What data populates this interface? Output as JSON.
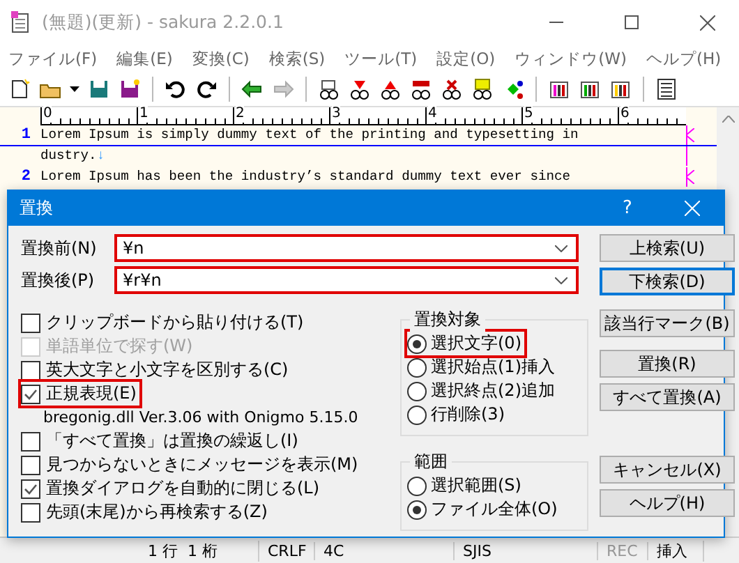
{
  "window": {
    "title": "(無題)(更新) - sakura 2.2.0.1"
  },
  "menu": [
    "ファイル(F)",
    "編集(E)",
    "変換(C)",
    "検索(S)",
    "ツール(T)",
    "設定(O)",
    "ウィンドウ(W)",
    "ヘルプ(H)"
  ],
  "ruler": [
    "0",
    "1",
    "2",
    "3",
    "4",
    "5",
    "6"
  ],
  "lines": [
    {
      "number": "1",
      "current": true,
      "rows": [
        {
          "text": "Lorem Ipsum is simply dummy text of the printing and typesetting in",
          "wrap": true
        },
        {
          "text": "dustry.",
          "wrap": false,
          "eol": "↓"
        }
      ]
    },
    {
      "number": "2",
      "current": false,
      "rows": [
        {
          "text": "Lorem Ipsum has been the industry’s standard dummy text ever since",
          "wrap": true
        }
      ]
    }
  ],
  "status": {
    "line": "1 行",
    "column": "1 桁",
    "eol": "CRLF",
    "code": "4C",
    "encoding": "SJIS",
    "rec": {
      "text": "REC",
      "on": false
    },
    "mode": "挿入"
  },
  "dialog": {
    "title": "置換",
    "help": "?",
    "fields": [
      {
        "label": "置換前(N)",
        "value": "¥n",
        "highlighted": true
      },
      {
        "label": "置換後(P)",
        "value": "¥r¥n",
        "highlighted": true
      }
    ],
    "options": [
      {
        "kind": "checkbox",
        "label": "クリップボードから貼り付ける(T)",
        "checked": false,
        "disabled": false,
        "highlighted": false
      },
      {
        "kind": "checkbox",
        "label": "単語単位で探す(W)",
        "checked": false,
        "disabled": true,
        "highlighted": false
      },
      {
        "kind": "checkbox",
        "label": "英大文字と小文字を区別する(C)",
        "checked": false,
        "disabled": false,
        "highlighted": false
      },
      {
        "kind": "checkbox",
        "label": "正規表現(E)",
        "checked": true,
        "disabled": false,
        "highlighted": true
      },
      {
        "kind": "note",
        "label": "bregonig.dll Ver.3.06 with Onigmo 5.15.0"
      },
      {
        "kind": "checkbox",
        "label": "「すべて置換」は置換の繰返し(I)",
        "checked": false,
        "disabled": false,
        "highlighted": false
      },
      {
        "kind": "checkbox",
        "label": "見つからないときにメッセージを表示(M)",
        "checked": false,
        "disabled": false,
        "highlighted": false
      },
      {
        "kind": "checkbox",
        "label": "置換ダイアログを自動的に閉じる(L)",
        "checked": true,
        "disabled": false,
        "highlighted": false
      },
      {
        "kind": "checkbox",
        "label": "先頭(末尾)から再検索する(Z)",
        "checked": false,
        "disabled": false,
        "highlighted": false
      }
    ],
    "groups": [
      {
        "title": "置換対象",
        "options": [
          {
            "label": "選択文字(0)",
            "selected": true,
            "highlighted": true
          },
          {
            "label": "選択始点(1)挿入",
            "selected": false,
            "highlighted": false
          },
          {
            "label": "選択終点(2)追加",
            "selected": false,
            "highlighted": false
          },
          {
            "label": "行削除(3)",
            "selected": false,
            "highlighted": false
          }
        ]
      },
      {
        "title": "範囲",
        "options": [
          {
            "label": "選択範囲(S)",
            "selected": false,
            "highlighted": false
          },
          {
            "label": "ファイル全体(O)",
            "selected": true,
            "highlighted": false
          }
        ]
      }
    ],
    "button_groups": [
      [
        {
          "label": "上検索(U)",
          "default": false
        },
        {
          "label": "下検索(D)",
          "default": true
        }
      ],
      [
        {
          "label": "該当行マーク(B)",
          "default": false
        },
        {
          "label": "置換(R)",
          "default": false
        },
        {
          "label": "すべて置換(A)",
          "default": false
        }
      ],
      [
        {
          "label": "キャンセル(X)",
          "default": false
        },
        {
          "label": "ヘルプ(H)",
          "default": false
        }
      ]
    ]
  }
}
